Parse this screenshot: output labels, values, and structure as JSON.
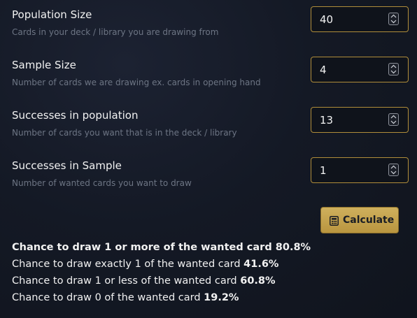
{
  "fields": [
    {
      "label": "Population Size",
      "hint": "Cards in your deck / library you are drawing from",
      "value": "40"
    },
    {
      "label": "Sample Size",
      "hint": "Number of cards we are drawing ex. cards in opening hand",
      "value": "4"
    },
    {
      "label": "Successes in population",
      "hint": "Number of cards you want that is in the deck / library",
      "value": "13"
    },
    {
      "label": "Successes in Sample",
      "hint": "Number of wanted cards you want to draw",
      "value": "1"
    }
  ],
  "calculate_button": {
    "label": "Calculate",
    "icon": "calculator-icon"
  },
  "results": [
    {
      "text": "Chance to draw 1 or more of the wanted card",
      "value": "80.8%"
    },
    {
      "text": "Chance to draw exactly 1 of the wanted card",
      "value": "41.6%"
    },
    {
      "text": "Chance to draw 1 or less of the wanted card",
      "value": "60.8%"
    },
    {
      "text": "Chance to draw 0 of the wanted card",
      "value": "19.2%"
    }
  ],
  "colors": {
    "accent_gold": "#c7a550",
    "input_border": "#b08d3a",
    "background": "#141925",
    "hint_text": "#6d7584"
  }
}
